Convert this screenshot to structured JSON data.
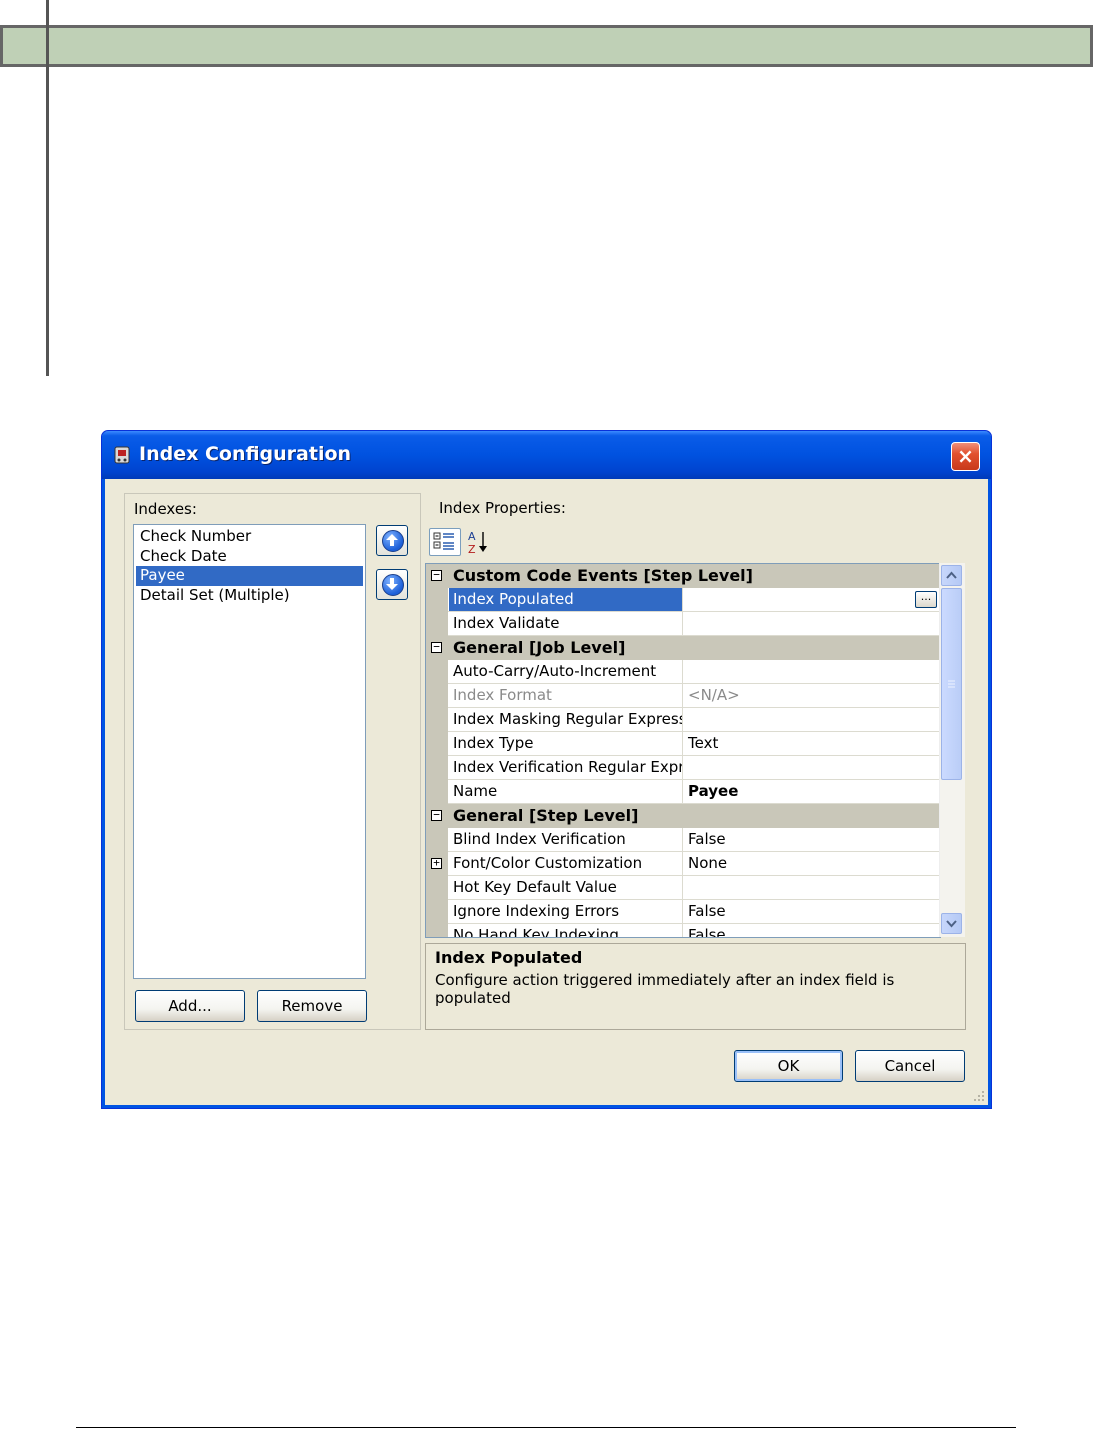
{
  "dialog": {
    "title": "Index Configuration",
    "close_label": "×"
  },
  "indexes": {
    "label": "Indexes:",
    "items": [
      "Check Number",
      "Check Date",
      "Payee",
      "Detail Set (Multiple)"
    ],
    "selected": "Payee",
    "add_label": "Add...",
    "remove_label": "Remove"
  },
  "properties": {
    "label": "Index Properties:",
    "rows": [
      {
        "type": "category",
        "expander": "−",
        "name": "Custom Code Events [Step Level]"
      },
      {
        "type": "prop",
        "name": "Index Populated",
        "value": "",
        "selected": true,
        "has_button": true
      },
      {
        "type": "prop",
        "name": "Index Validate",
        "value": ""
      },
      {
        "type": "category",
        "expander": "−",
        "name": "General [Job Level]"
      },
      {
        "type": "prop",
        "name": "Auto-Carry/Auto-Increment",
        "value": ""
      },
      {
        "type": "prop",
        "name": "Index Format",
        "value": "<N/A>",
        "disabled": true
      },
      {
        "type": "prop",
        "name": "Index Masking Regular Expressi",
        "value": ""
      },
      {
        "type": "prop",
        "name": "Index Type",
        "value": "Text"
      },
      {
        "type": "prop",
        "name": "Index Verification Regular Expre",
        "value": ""
      },
      {
        "type": "prop",
        "name": "Name",
        "value": "Payee",
        "bold": true
      },
      {
        "type": "category",
        "expander": "−",
        "name": "General [Step Level]"
      },
      {
        "type": "prop",
        "name": "Blind Index Verification",
        "value": "False"
      },
      {
        "type": "prop",
        "name": "Font/Color Customization",
        "value": "None",
        "expander": "+"
      },
      {
        "type": "prop",
        "name": "Hot Key Default Value",
        "value": ""
      },
      {
        "type": "prop",
        "name": "Ignore Indexing Errors",
        "value": "False"
      },
      {
        "type": "prop",
        "name": "No Hand Key Indexing",
        "value": "False"
      }
    ],
    "ellipsis_label": "..."
  },
  "description": {
    "title": "Index Populated",
    "text": "Configure action triggered immediately after an index field is populated"
  },
  "buttons": {
    "ok_label": "OK",
    "cancel_label": "Cancel"
  },
  "colors": {
    "selection": "#316ac5",
    "titlebar": "#0052e0",
    "dialog_bg": "#ece9d8"
  }
}
